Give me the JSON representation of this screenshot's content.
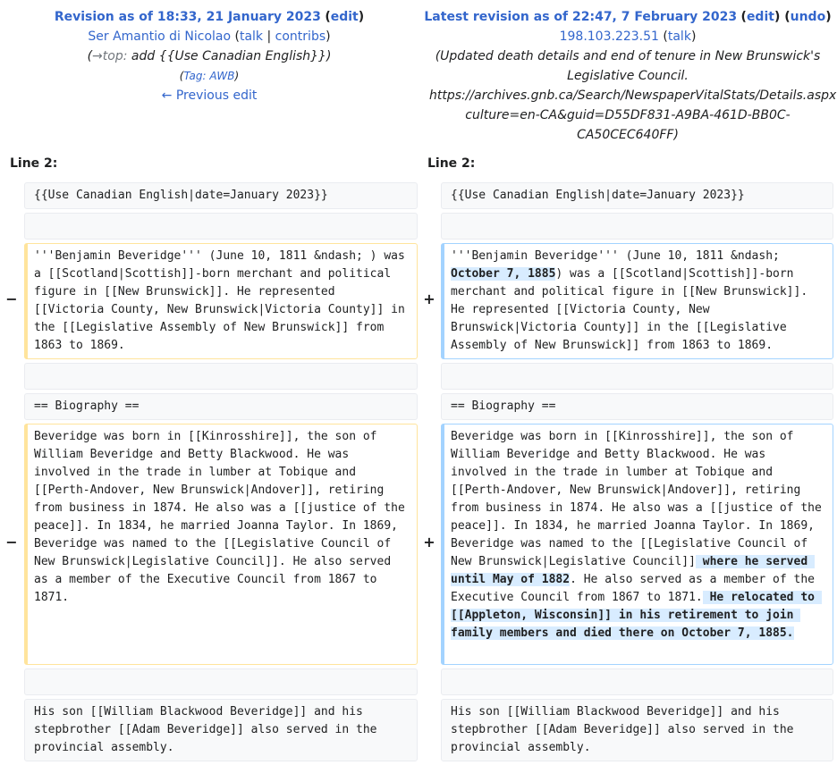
{
  "left_header": {
    "title": "Revision as of 18:33, 21 January 2023",
    "edit": "edit",
    "user": "Ser Amantio di Nicolao",
    "talk": "talk",
    "contribs": "contribs",
    "summary_arrow": "→top:",
    "summary_text": "add {{Use Canadian English}}",
    "tag_label": "Tag:",
    "tag_value": "AWB",
    "previous_edit": "← Previous edit"
  },
  "right_header": {
    "title": "Latest revision as of 22:47, 7 February 2023",
    "edit": "edit",
    "undo": "undo",
    "user": "198.103.223.51",
    "talk": "talk",
    "summary": "Updated death details and end of tenure in New Brunswick's Legislative Council. https://archives.gnb.ca/Search/NewspaperVitalStats/Details.aspx?culture=en-CA&guid=D55DF831-A9BA-461D-BB0C-CA50CEC640FF"
  },
  "line_label": "Line 2:",
  "markers": {
    "minus": "−",
    "plus": "+"
  },
  "rows": {
    "r1": "{{Use Canadian English|date=January 2023}}",
    "r3_left": "'''Benjamin Beveridge''' (June 10, 1811 &ndash; ) was a [[Scotland|Scottish]]-born merchant and political figure in [[New Brunswick]]. He represented [[Victoria County, New Brunswick|Victoria County]] in the [[Legislative Assembly of New Brunswick]] from 1863 to 1869.",
    "r3_right_a": "'''Benjamin Beveridge''' (June 10, 1811 &ndash; ",
    "r3_right_ins": "October 7, 1885",
    "r3_right_b": ") was a [[Scotland|Scottish]]-born merchant and political figure in [[New Brunswick]]. He represented [[Victoria County, New Brunswick|Victoria County]] in the [[Legislative Assembly of New Brunswick]] from 1863 to 1869.",
    "r5": "== Biography ==",
    "r6_left": "Beveridge was born in [[Kinrosshire]], the son of William Beveridge and Betty Blackwood. He was involved in the trade in lumber at Tobique and [[Perth-Andover, New Brunswick|Andover]], retiring from business in 1874. He also was a [[justice of the peace]]. In 1834, he married Joanna Taylor. In 1869, Beveridge was named to the [[Legislative Council of New Brunswick|Legislative Council]]. He also served as a member of the Executive Council from 1867 to 1871.",
    "r6_right_a": "Beveridge was born in [[Kinrosshire]], the son of William Beveridge and Betty Blackwood. He was involved in the trade in lumber at Tobique and [[Perth-Andover, New Brunswick|Andover]], retiring from business in 1874. He also was a [[justice of the peace]]. In 1834, he married Joanna Taylor. In 1869, Beveridge was named to the [[Legislative Council of New Brunswick|Legislative Council]]",
    "r6_right_ins1": " where he served until May of 1882",
    "r6_right_b": ". He also served as a member of the Executive Council from 1867 to 1871.",
    "r6_right_ins2": " He relocated to [[Appleton, Wisconsin]] in his retirement to join family members and died there on October 7, 1885.",
    "r8": "His son [[William Blackwood Beveridge]] and his stepbrother [[Adam Beveridge]] also served in the provincial assembly."
  }
}
